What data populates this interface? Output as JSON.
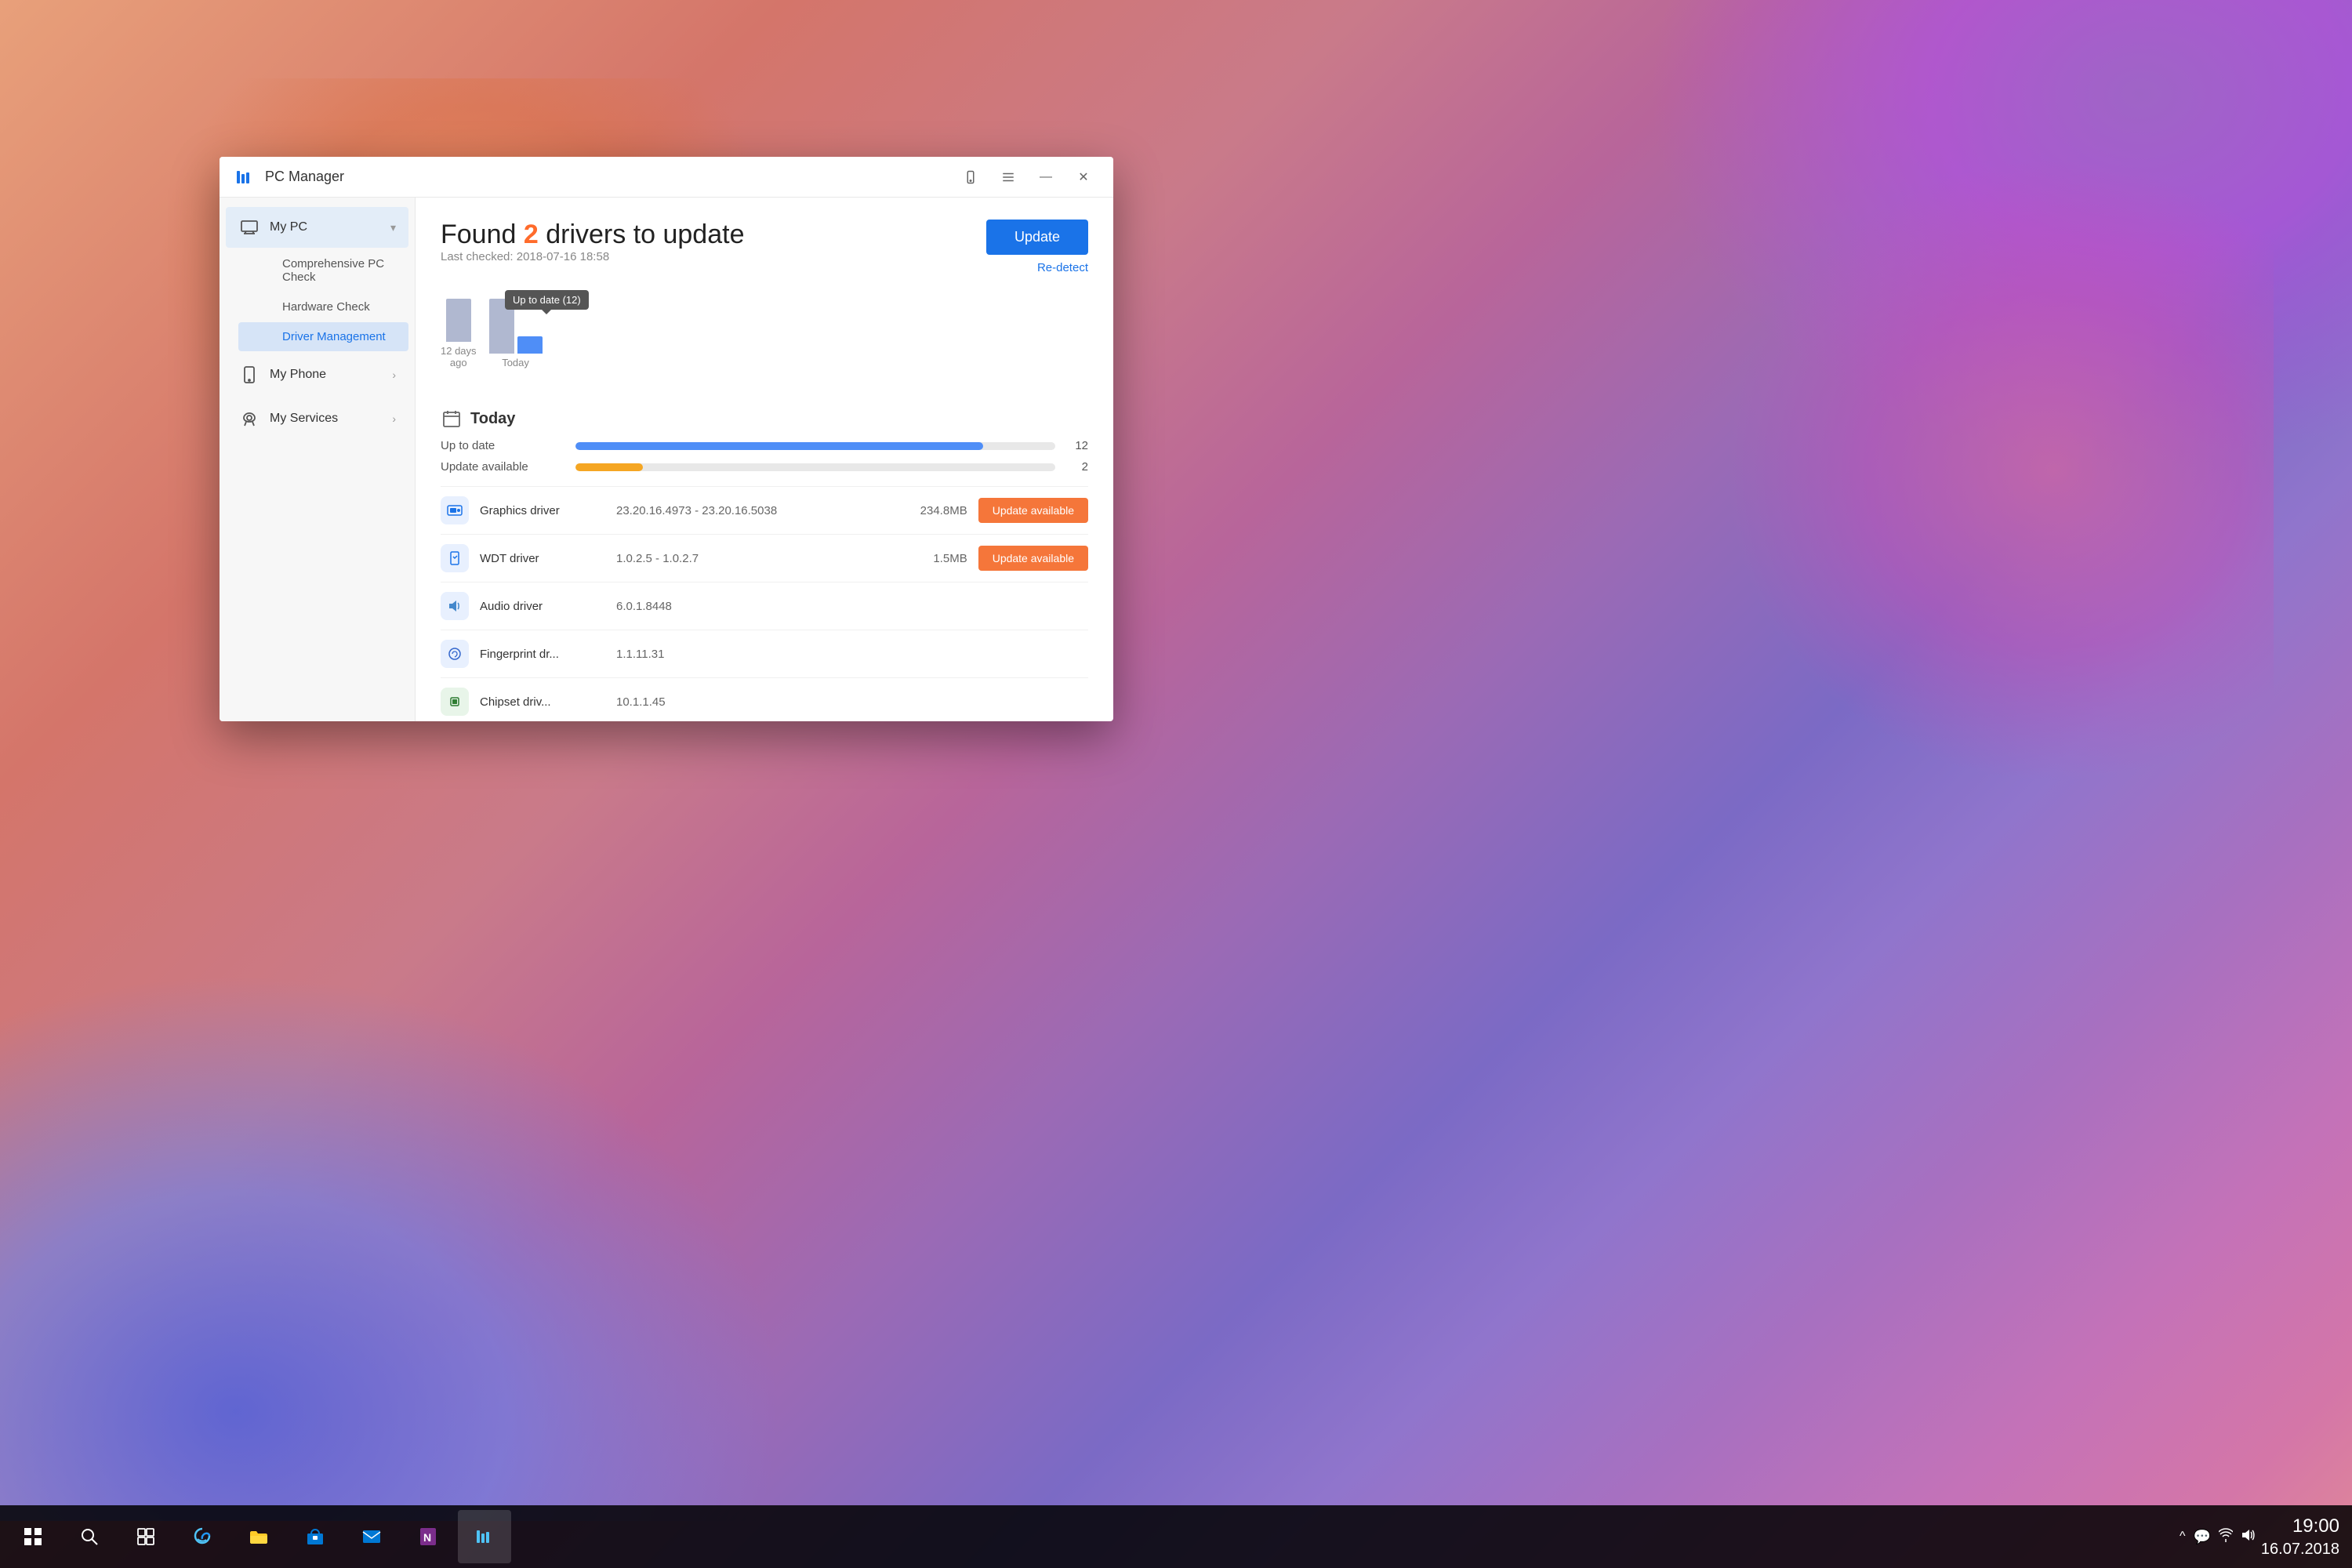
{
  "desktop": {},
  "taskbar": {
    "icons": [
      {
        "name": "windows-start",
        "symbol": "⊞"
      },
      {
        "name": "search",
        "symbol": "🔍"
      },
      {
        "name": "task-view",
        "symbol": "❑"
      },
      {
        "name": "edge-browser",
        "symbol": "e"
      },
      {
        "name": "file-explorer",
        "symbol": "📁"
      },
      {
        "name": "store",
        "symbol": "🛍"
      },
      {
        "name": "mail",
        "symbol": "✉"
      },
      {
        "name": "onenote",
        "symbol": "N"
      },
      {
        "name": "pc-manager",
        "symbol": "M"
      }
    ],
    "sys_icons": [
      "^",
      "🔔",
      "💬",
      "🔊",
      "📡"
    ],
    "time": "19:00",
    "date": "16.07.2018"
  },
  "window": {
    "title": "PC Manager",
    "logo": "📊",
    "controls": {
      "phone": "📱",
      "menu": "≡",
      "minimize": "—",
      "close": "✕"
    }
  },
  "sidebar": {
    "items": [
      {
        "id": "my-pc",
        "label": "My PC",
        "icon": "🖥",
        "expandable": true,
        "expanded": true,
        "children": [
          {
            "id": "comprehensive-pc-check",
            "label": "Comprehensive PC Check",
            "active": false
          },
          {
            "id": "hardware-check",
            "label": "Hardware Check",
            "active": false
          },
          {
            "id": "driver-management",
            "label": "Driver Management",
            "active": true
          }
        ]
      },
      {
        "id": "my-phone",
        "label": "My Phone",
        "icon": "📱",
        "expandable": true,
        "expanded": false,
        "children": []
      },
      {
        "id": "my-services",
        "label": "My Services",
        "icon": "🎧",
        "expandable": true,
        "expanded": false,
        "children": []
      }
    ]
  },
  "main": {
    "found_prefix": "Found ",
    "found_count": "2",
    "found_suffix": " drivers to update",
    "last_checked_label": "Last checked: 2018-07-16 18:58",
    "update_button_label": "Update",
    "re_detect_label": "Re-detect",
    "tooltip_label": "Up to date (12)",
    "chart": {
      "bars": [
        {
          "label": "12 days\nago",
          "up_to_date_height": 55,
          "update_avail_height": 0
        },
        {
          "label": "Today",
          "up_to_date_height": 70,
          "update_avail_height": 20
        }
      ]
    },
    "today_label": "Today",
    "progress_rows": [
      {
        "label": "Up to date",
        "fill_pct": 85,
        "color": "blue",
        "count": "12"
      },
      {
        "label": "Update available",
        "fill_pct": 14,
        "color": "orange",
        "count": "2"
      }
    ],
    "drivers": [
      {
        "name": "Graphics driver",
        "version": "23.20.16.4973 - 23.20.16.5038",
        "size": "234.8MB",
        "status": "update",
        "icon_type": "graphics",
        "icon_symbol": "📹"
      },
      {
        "name": "WDT driver",
        "version": "1.0.2.5 - 1.0.2.7",
        "size": "1.5MB",
        "status": "update",
        "icon_type": "wdt",
        "icon_symbol": "🔒"
      },
      {
        "name": "Audio driver",
        "version": "6.0.1.8448",
        "size": "",
        "status": "ok",
        "icon_type": "audio",
        "icon_symbol": "🔊"
      },
      {
        "name": "Fingerprint dr...",
        "version": "1.1.11.31",
        "size": "",
        "status": "ok",
        "icon_type": "fingerprint",
        "icon_symbol": "👆"
      },
      {
        "name": "Chipset driv...",
        "version": "10.1.1.45",
        "size": "",
        "status": "ok",
        "icon_type": "chip",
        "icon_symbol": "💾"
      }
    ],
    "update_available_label": "Update available"
  }
}
